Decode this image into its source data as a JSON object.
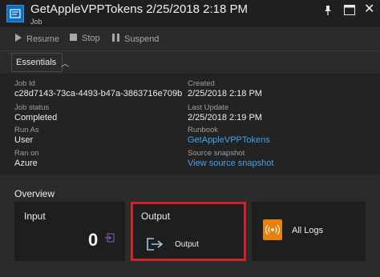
{
  "header": {
    "title": "GetAppleVPPTokens 2/25/2018 2:18 PM",
    "subtitle": "Job"
  },
  "toolbar": {
    "resume": "Resume",
    "stop": "Stop",
    "suspend": "Suspend"
  },
  "essentials": {
    "tab_label": "Essentials",
    "job_id_label": "Job Id",
    "job_id": "c28d7143-73ca-4493-b47a-3863716e709b",
    "job_status_label": "Job status",
    "job_status": "Completed",
    "run_as_label": "Run As",
    "run_as": "User",
    "ran_on_label": "Ran on",
    "ran_on": "Azure",
    "created_label": "Created",
    "created": "2/25/2018 2:18 PM",
    "last_update_label": "Last Update",
    "last_update": "2/25/2018 2:19 PM",
    "runbook_label": "Runbook",
    "runbook": "GetAppleVPPTokens",
    "source_snapshot_label": "Source snapshot",
    "source_snapshot": "View source snapshot"
  },
  "overview": {
    "title": "Overview",
    "input_title": "Input",
    "input_count": "0",
    "output_title": "Output",
    "output_link": "Output",
    "all_logs": "All Logs"
  },
  "colors": {
    "accent_link": "#3fa3f0",
    "highlight_border": "#d0222b",
    "logs_icon": "#e8810a",
    "job_icon": "#0b6fc6"
  }
}
